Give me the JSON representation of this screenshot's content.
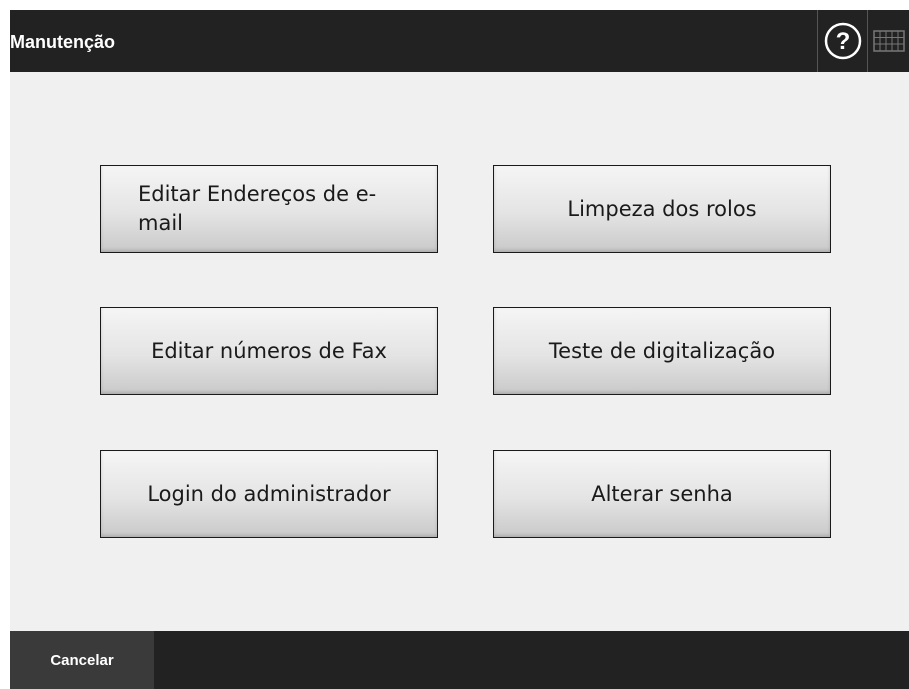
{
  "header": {
    "title": "Manutenção",
    "help_icon": "help-circle-icon",
    "keyboard_icon": "keyboard-icon"
  },
  "buttons": [
    {
      "label": "Editar Endereços de e-mail"
    },
    {
      "label": "Limpeza dos rolos"
    },
    {
      "label": "Editar números de Fax"
    },
    {
      "label": "Teste de digitalização"
    },
    {
      "label": "Login do administrador"
    },
    {
      "label": "Alterar senha"
    }
  ],
  "footer": {
    "cancel_label": "Cancelar"
  },
  "colors": {
    "bar_background": "#222222",
    "content_background": "#f0f0f0",
    "cancel_background": "#3a3a3a"
  }
}
